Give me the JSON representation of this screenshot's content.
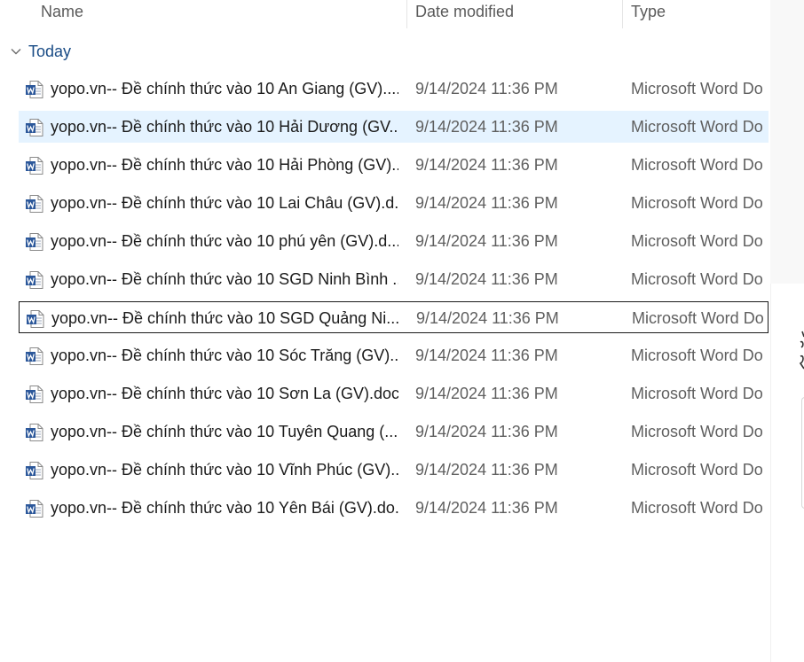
{
  "columns": {
    "name": "Name",
    "date_modified": "Date modified",
    "type": "Type"
  },
  "group": {
    "label": "Today",
    "icon": "chevron-down-icon"
  },
  "files": [
    {
      "name": "yopo.vn-- Đề chính thức vào 10 An Giang (GV)....",
      "date": "9/14/2024 11:36 PM",
      "type": "Microsoft Word Do",
      "icon": "word-document-icon"
    },
    {
      "name": "yopo.vn-- Đề chính thức vào 10 Hải Dương (GV...",
      "date": "9/14/2024 11:36 PM",
      "type": "Microsoft Word Do",
      "icon": "word-document-icon"
    },
    {
      "name": "yopo.vn-- Đề chính thức vào 10 Hải Phòng (GV)...",
      "date": "9/14/2024 11:36 PM",
      "type": "Microsoft Word Do",
      "icon": "word-document-icon"
    },
    {
      "name": "yopo.vn-- Đề chính thức vào 10 Lai Châu (GV).d...",
      "date": "9/14/2024 11:36 PM",
      "type": "Microsoft Word Do",
      "icon": "word-document-icon"
    },
    {
      "name": "yopo.vn-- Đề chính thức vào 10 phú yên (GV).d...",
      "date": "9/14/2024 11:36 PM",
      "type": "Microsoft Word Do",
      "icon": "word-document-icon"
    },
    {
      "name": "yopo.vn-- Đề chính thức vào 10 SGD Ninh Bình ...",
      "date": "9/14/2024 11:36 PM",
      "type": "Microsoft Word Do",
      "icon": "word-document-icon"
    },
    {
      "name": "yopo.vn-- Đề chính thức vào 10 SGD Quảng Ni...",
      "date": "9/14/2024 11:36 PM",
      "type": "Microsoft Word Do",
      "icon": "word-document-icon"
    },
    {
      "name": "yopo.vn-- Đề chính thức vào 10 Sóc Trăng (GV)....",
      "date": "9/14/2024 11:36 PM",
      "type": "Microsoft Word Do",
      "icon": "word-document-icon"
    },
    {
      "name": "yopo.vn-- Đề chính thức vào 10 Sơn La (GV).docx",
      "date": "9/14/2024 11:36 PM",
      "type": "Microsoft Word Do",
      "icon": "word-document-icon"
    },
    {
      "name": "yopo.vn-- Đề chính thức vào 10 Tuyên Quang (...",
      "date": "9/14/2024 11:36 PM",
      "type": "Microsoft Word Do",
      "icon": "word-document-icon"
    },
    {
      "name": "yopo.vn-- Đề chính thức vào 10 Vĩnh Phúc (GV)....",
      "date": "9/14/2024 11:36 PM",
      "type": "Microsoft Word Do",
      "icon": "word-document-icon"
    },
    {
      "name": "yopo.vn-- Đề chính thức vào 10 Yên Bái (GV).do...",
      "date": "9/14/2024 11:36 PM",
      "type": "Microsoft Word Do",
      "icon": "word-document-icon"
    }
  ],
  "state": {
    "hovered_index": 1,
    "focused_index": 6
  },
  "colors": {
    "hover_background": "#e5f3ff",
    "group_label": "#1a4c86",
    "word_blue": "#2b579a"
  }
}
